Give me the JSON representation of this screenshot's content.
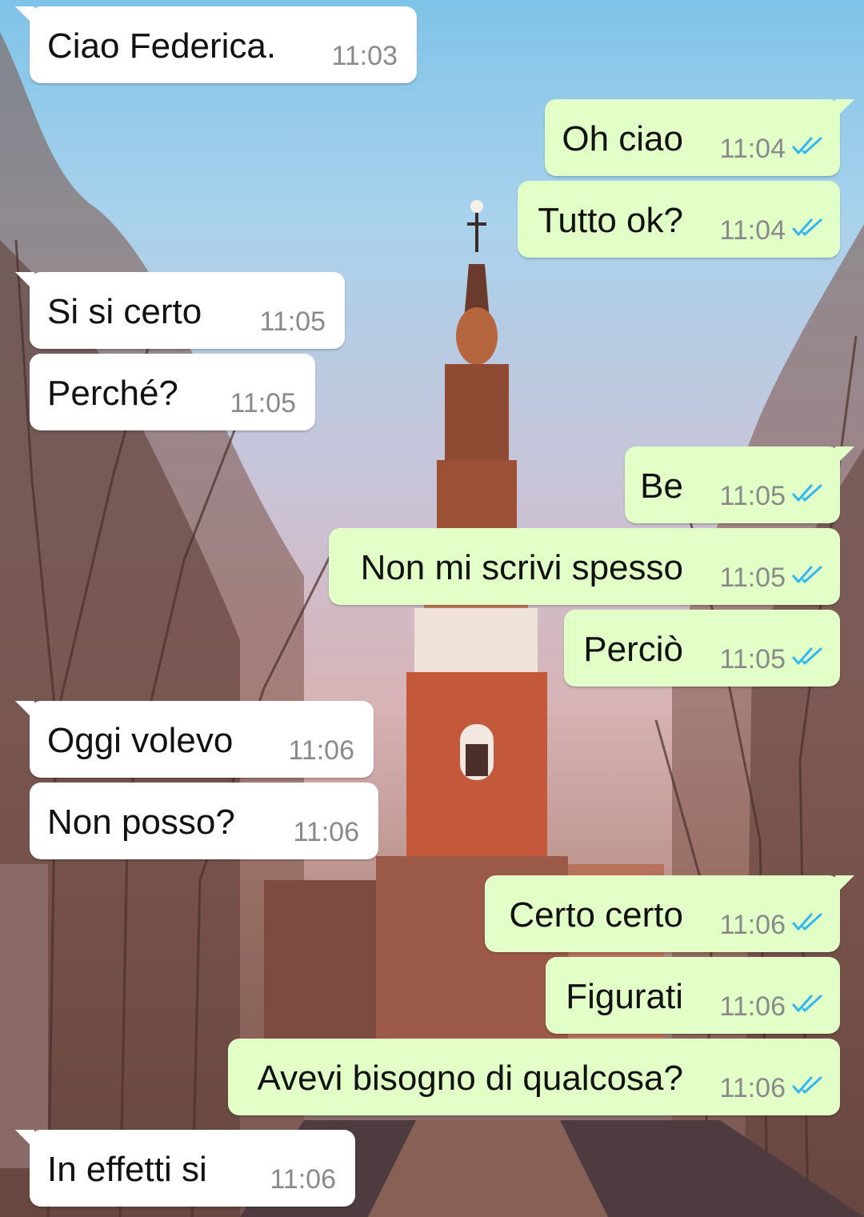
{
  "chat": {
    "messages": [
      {
        "direction": "incoming",
        "text": "Ciao Federica.",
        "time": "11:03"
      },
      {
        "direction": "outgoing",
        "text": "Oh ciao",
        "time": "11:04",
        "status": "read"
      },
      {
        "direction": "outgoing",
        "text": "Tutto ok?",
        "time": "11:04",
        "status": "read"
      },
      {
        "direction": "incoming",
        "text": "Si si certo",
        "time": "11:05"
      },
      {
        "direction": "incoming",
        "text": "Perché?",
        "time": "11:05"
      },
      {
        "direction": "outgoing",
        "text": "Be",
        "time": "11:05",
        "status": "read"
      },
      {
        "direction": "outgoing",
        "text": "Non mi scrivi spesso",
        "time": "11:05",
        "status": "read"
      },
      {
        "direction": "outgoing",
        "text": "Perciò",
        "time": "11:05",
        "status": "read"
      },
      {
        "direction": "incoming",
        "text": "Oggi volevo",
        "time": "11:06"
      },
      {
        "direction": "incoming",
        "text": "Non posso?",
        "time": "11:06"
      },
      {
        "direction": "outgoing",
        "text": "Certo certo",
        "time": "11:06",
        "status": "read"
      },
      {
        "direction": "outgoing",
        "text": "Figurati",
        "time": "11:06",
        "status": "read"
      },
      {
        "direction": "outgoing",
        "text": "Avevi bisogno di qualcosa?",
        "time": "11:06",
        "status": "read"
      },
      {
        "direction": "incoming",
        "text": "In effetti si",
        "time": "11:06"
      }
    ]
  },
  "theme": {
    "incoming_bubble": "#ffffff",
    "outgoing_bubble": "#e1ffc7",
    "read_tick_color": "#34b7f1",
    "wallpaper": "city-canal-church-tower-photo"
  }
}
